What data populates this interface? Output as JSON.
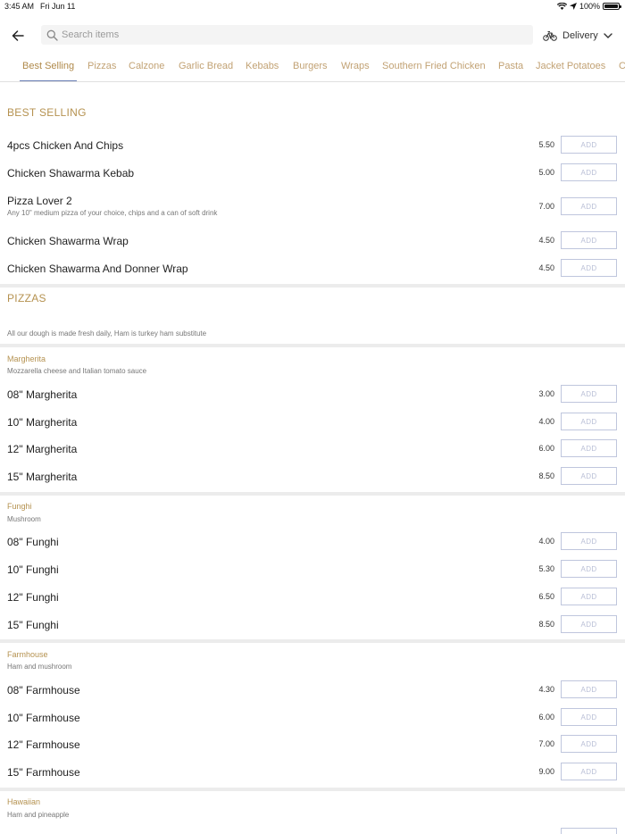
{
  "status_bar": {
    "time": "3:45 AM",
    "date": "Fri Jun 11",
    "battery": "100%"
  },
  "search": {
    "placeholder": "Search items"
  },
  "delivery_label": "Delivery",
  "tabs": [
    "Best Selling",
    "Pizzas",
    "Calzone",
    "Garlic Bread",
    "Kebabs",
    "Burgers",
    "Wraps",
    "Southern Fried Chicken",
    "Pasta",
    "Jacket Potatoes",
    "C"
  ],
  "add_label": "ADD",
  "best_selling": {
    "title": "BEST SELLING",
    "items": [
      {
        "name": "4pcs Chicken And Chips",
        "price": "5.50"
      },
      {
        "name": "Chicken Shawarma Kebab",
        "price": "5.00"
      },
      {
        "name": "Pizza Lover 2",
        "desc": "Any 10\" medium pizza of your choice, chips and a can of soft drink",
        "price": "7.00"
      },
      {
        "name": "Chicken Shawarma Wrap",
        "price": "4.50"
      },
      {
        "name": "Chicken Shawarma And Donner Wrap",
        "price": "4.50"
      }
    ]
  },
  "pizzas": {
    "title": "PIZZAS",
    "note": "All our dough is made fresh daily, Ham is turkey ham substitute",
    "groups": [
      {
        "title": "Margherita",
        "desc": "Mozzarella cheese and Italian tomato sauce",
        "items": [
          {
            "name": "08\" Margherita",
            "price": "3.00"
          },
          {
            "name": "10\" Margherita",
            "price": "4.00"
          },
          {
            "name": "12\" Margherita",
            "price": "6.00"
          },
          {
            "name": "15\" Margherita",
            "price": "8.50"
          }
        ]
      },
      {
        "title": "Funghi",
        "desc": "Mushroom",
        "items": [
          {
            "name": "08\" Funghi",
            "price": "4.00"
          },
          {
            "name": "10\" Funghi",
            "price": "5.30"
          },
          {
            "name": "12\" Funghi",
            "price": "6.50"
          },
          {
            "name": "15\" Funghi",
            "price": "8.50"
          }
        ]
      },
      {
        "title": "Farmhouse",
        "desc": "Ham and mushroom",
        "items": [
          {
            "name": "08\" Farmhouse",
            "price": "4.30"
          },
          {
            "name": "10\" Farmhouse",
            "price": "6.00"
          },
          {
            "name": "12\" Farmhouse",
            "price": "7.00"
          },
          {
            "name": "15\" Farmhouse",
            "price": "9.00"
          }
        ]
      },
      {
        "title": "Hawaiian",
        "desc": "Ham and pineapple",
        "items": []
      }
    ]
  }
}
